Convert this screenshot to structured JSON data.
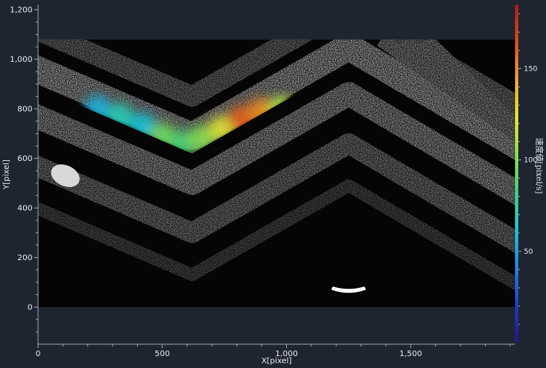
{
  "chart_data": {
    "type": "heatmap",
    "xlabel": "X[pixel]",
    "ylabel": "Y[pixel]",
    "xlim": [
      0,
      1920
    ],
    "ylim": [
      -150,
      1220
    ],
    "x_ticks": [
      0,
      500,
      1000,
      1500
    ],
    "x_tick_labels": [
      "0",
      "500",
      "1,000",
      "1,500"
    ],
    "y_ticks": [
      0,
      200,
      400,
      600,
      800,
      1000,
      1200
    ],
    "y_tick_labels": [
      "0",
      "200",
      "400",
      "600",
      "800",
      "1,000",
      "1,200"
    ],
    "image_extent": {
      "x": [
        0,
        1920
      ],
      "y": [
        0,
        1080
      ]
    },
    "colorbar": {
      "title": "速度値[pixel/s]",
      "range": [
        0,
        185
      ],
      "ticks": [
        50,
        100,
        150
      ],
      "tick_labels": [
        "50",
        "100",
        "150"
      ],
      "colormap": [
        "#2a1290",
        "#1e3ec8",
        "#1c86e8",
        "#19c8d8",
        "#3fd67e",
        "#8fe04a",
        "#e8e632",
        "#f3a71f",
        "#e24a1a",
        "#b8161a"
      ]
    },
    "velocity_field": {
      "description_points": [
        {
          "x": 240,
          "y": 800,
          "v": 55
        },
        {
          "x": 330,
          "y": 770,
          "v": 70
        },
        {
          "x": 420,
          "y": 730,
          "v": 60
        },
        {
          "x": 500,
          "y": 690,
          "v": 95
        },
        {
          "x": 580,
          "y": 660,
          "v": 85
        },
        {
          "x": 660,
          "y": 680,
          "v": 100
        },
        {
          "x": 740,
          "y": 720,
          "v": 120
        },
        {
          "x": 820,
          "y": 760,
          "v": 160
        },
        {
          "x": 900,
          "y": 790,
          "v": 150
        },
        {
          "x": 980,
          "y": 800,
          "v": 110
        }
      ]
    }
  }
}
